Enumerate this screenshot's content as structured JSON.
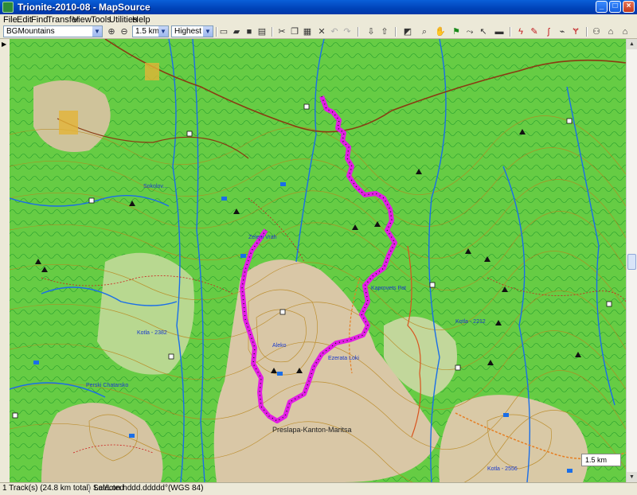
{
  "window": {
    "title": "Trionite-2010-08 - MapSource"
  },
  "menu": [
    "File",
    "Edit",
    "Find",
    "Transfer",
    "View",
    "Tools",
    "Utilities",
    "Help"
  ],
  "toolbar": {
    "product": "BGMountains",
    "zoom": "1.5 km",
    "detail": "Highest"
  },
  "map": {
    "scale_label": "1.5 km",
    "track_color": "#e21ee4",
    "labels": [
      {
        "text": "Preslapa-Kanton-Maritsa",
        "cls": "bold"
      },
      {
        "text": "Sokolov..."
      },
      {
        "text": "Kotla - 2556"
      },
      {
        "text": "Zeleni Vrah"
      },
      {
        "text": "Aleko"
      },
      {
        "text": "Kaprovets Pat"
      },
      {
        "text": "Kotla - 2382"
      },
      {
        "text": "Ezerata Loki"
      },
      {
        "text": "Perski Chatarsko"
      },
      {
        "text": "Kotla - 2212"
      }
    ]
  },
  "status": {
    "selection": "1 Track(s) (24.8 km total) Selected",
    "coord_format": "Lat/Lon hddd.ddddd°(WGS 84)"
  }
}
